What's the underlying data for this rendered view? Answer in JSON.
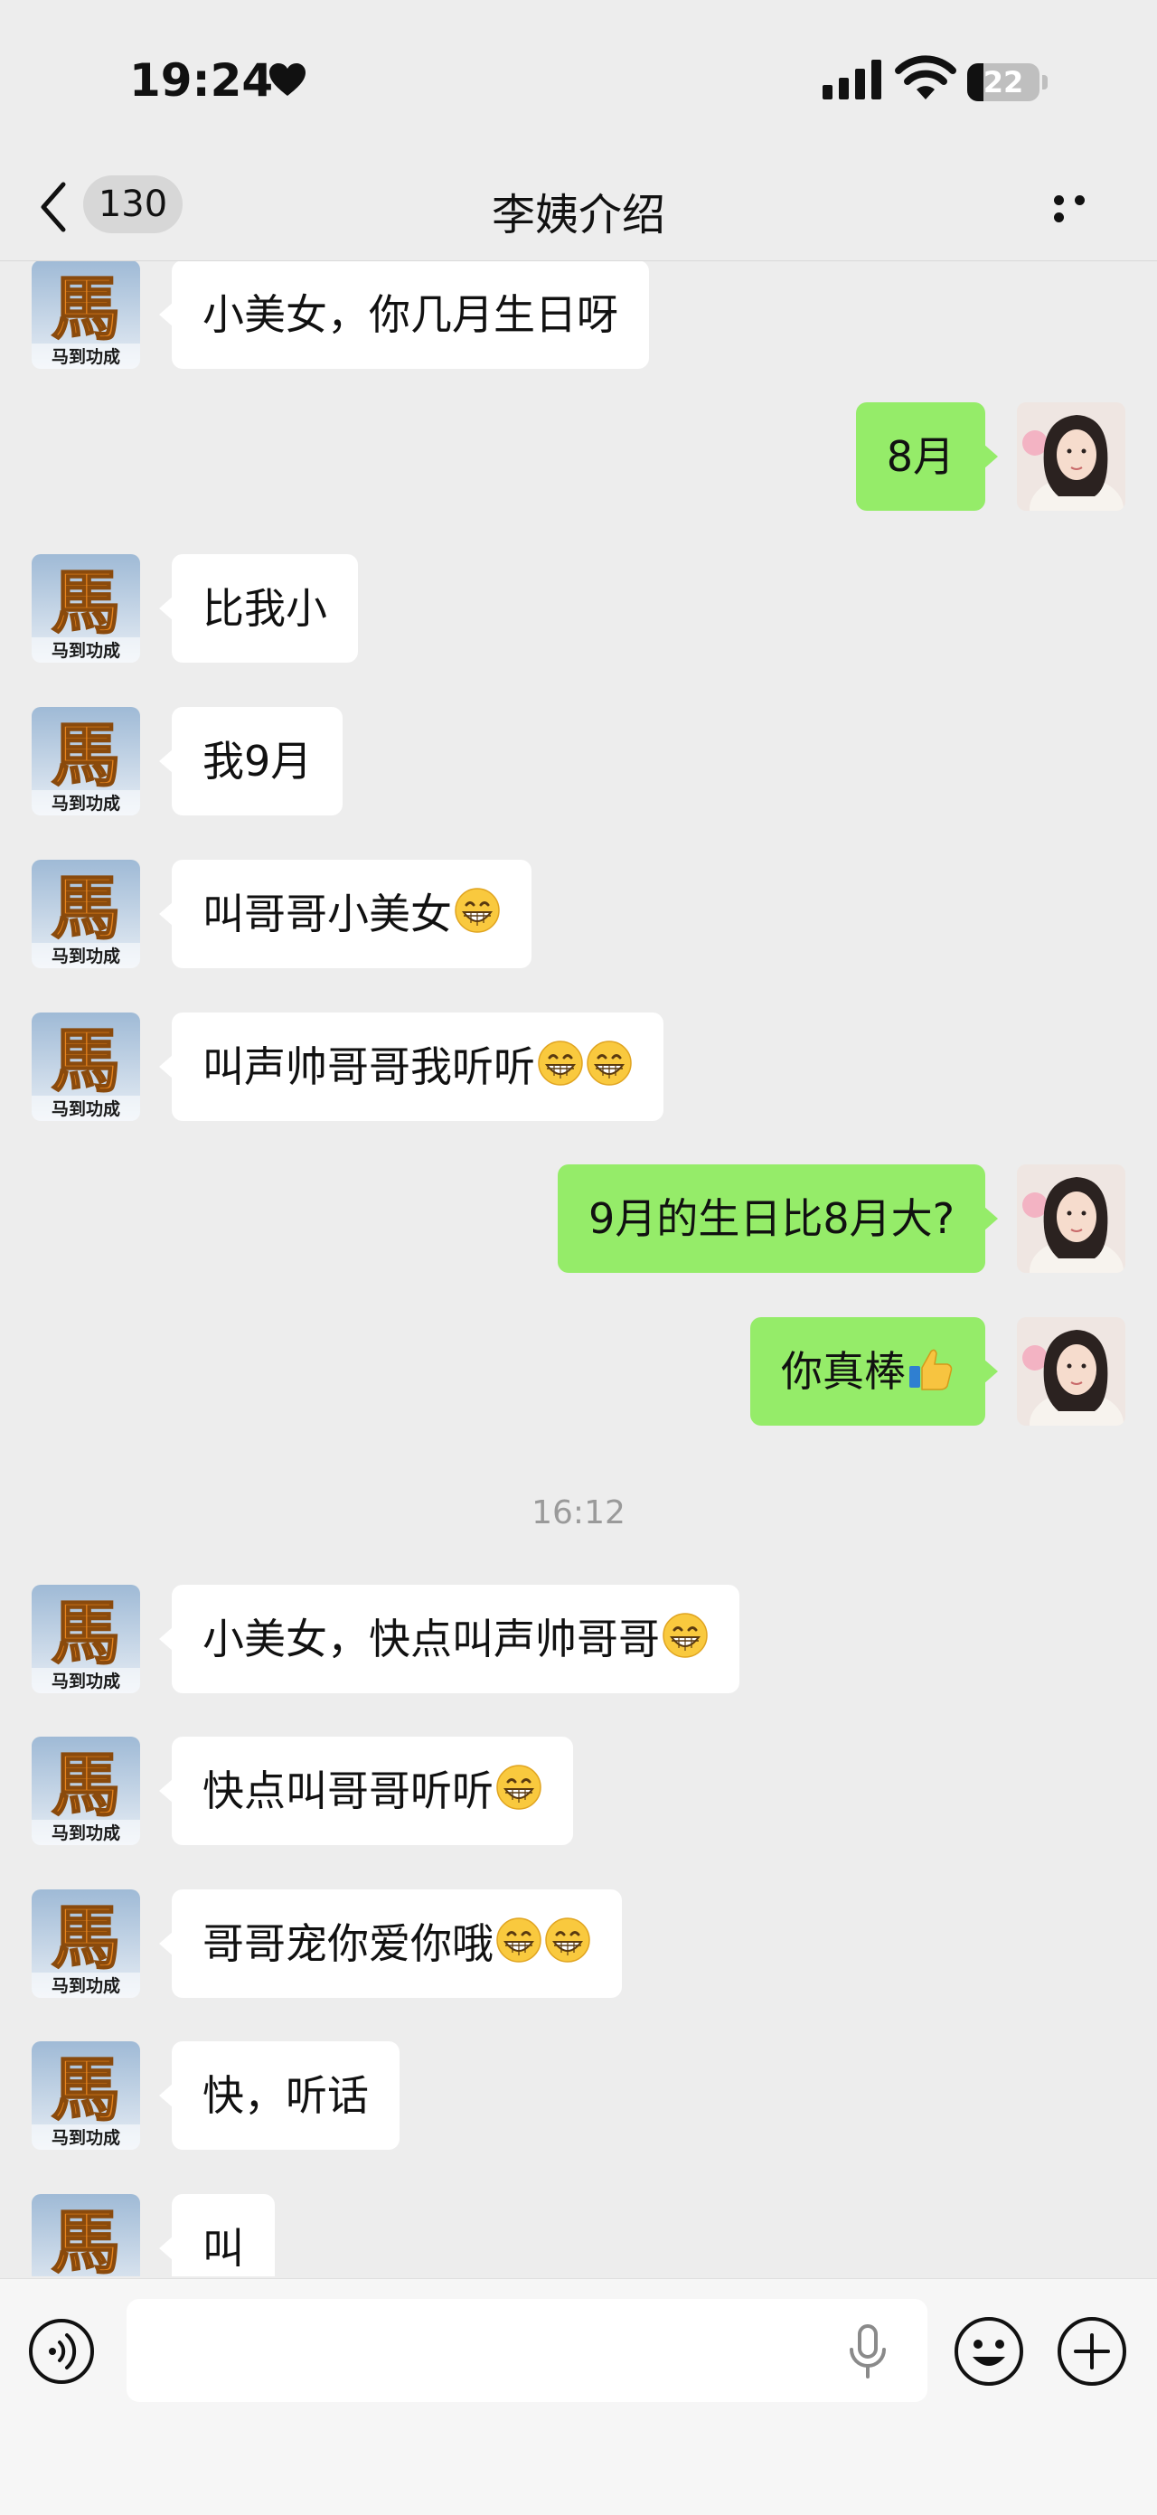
{
  "status_bar": {
    "time": "19:24",
    "battery": "22"
  },
  "nav": {
    "back_count": "130",
    "title": "李姨介绍"
  },
  "messages": [
    {
      "side": "left",
      "text": "小美女，你几月生日呀",
      "emoji_count": 0,
      "emoji": ""
    },
    {
      "side": "right",
      "text": "8月",
      "emoji_count": 0,
      "emoji": ""
    },
    {
      "side": "left",
      "text": "比我小",
      "emoji_count": 0,
      "emoji": ""
    },
    {
      "side": "left",
      "text": "我9月",
      "emoji_count": 0,
      "emoji": ""
    },
    {
      "side": "left",
      "text": "叫哥哥小美女",
      "emoji_count": 1,
      "emoji": "grin"
    },
    {
      "side": "left",
      "text": "叫声帅哥哥我听听",
      "emoji_count": 2,
      "emoji": "grin"
    },
    {
      "side": "right",
      "text": "9月的生日比8月大?",
      "emoji_count": 0,
      "emoji": ""
    },
    {
      "side": "right",
      "text": "你真棒",
      "emoji_count": 1,
      "emoji": "thumbs-up"
    },
    {
      "side": "left",
      "text": "小美女，快点叫声帅哥哥",
      "emoji_count": 1,
      "emoji": "grin"
    },
    {
      "side": "left",
      "text": "快点叫哥哥听听",
      "emoji_count": 1,
      "emoji": "grin"
    },
    {
      "side": "left",
      "text": "哥哥宠你爱你哦",
      "emoji_count": 2,
      "emoji": "grin"
    },
    {
      "side": "left",
      "text": "快，听话",
      "emoji_count": 0,
      "emoji": ""
    },
    {
      "side": "left",
      "text": "叫",
      "emoji_count": 0,
      "emoji": ""
    }
  ],
  "timestamp": "16:12",
  "avatar_left": {
    "caption": "马到功成",
    "glyph": "馬"
  },
  "colors": {
    "self_bubble": "#95ec69",
    "other_bubble": "#ffffff",
    "background": "#ededed"
  },
  "input_bar": {
    "icons": [
      "voice-icon",
      "microphone-icon",
      "emoji-icon",
      "plus-icon"
    ]
  }
}
